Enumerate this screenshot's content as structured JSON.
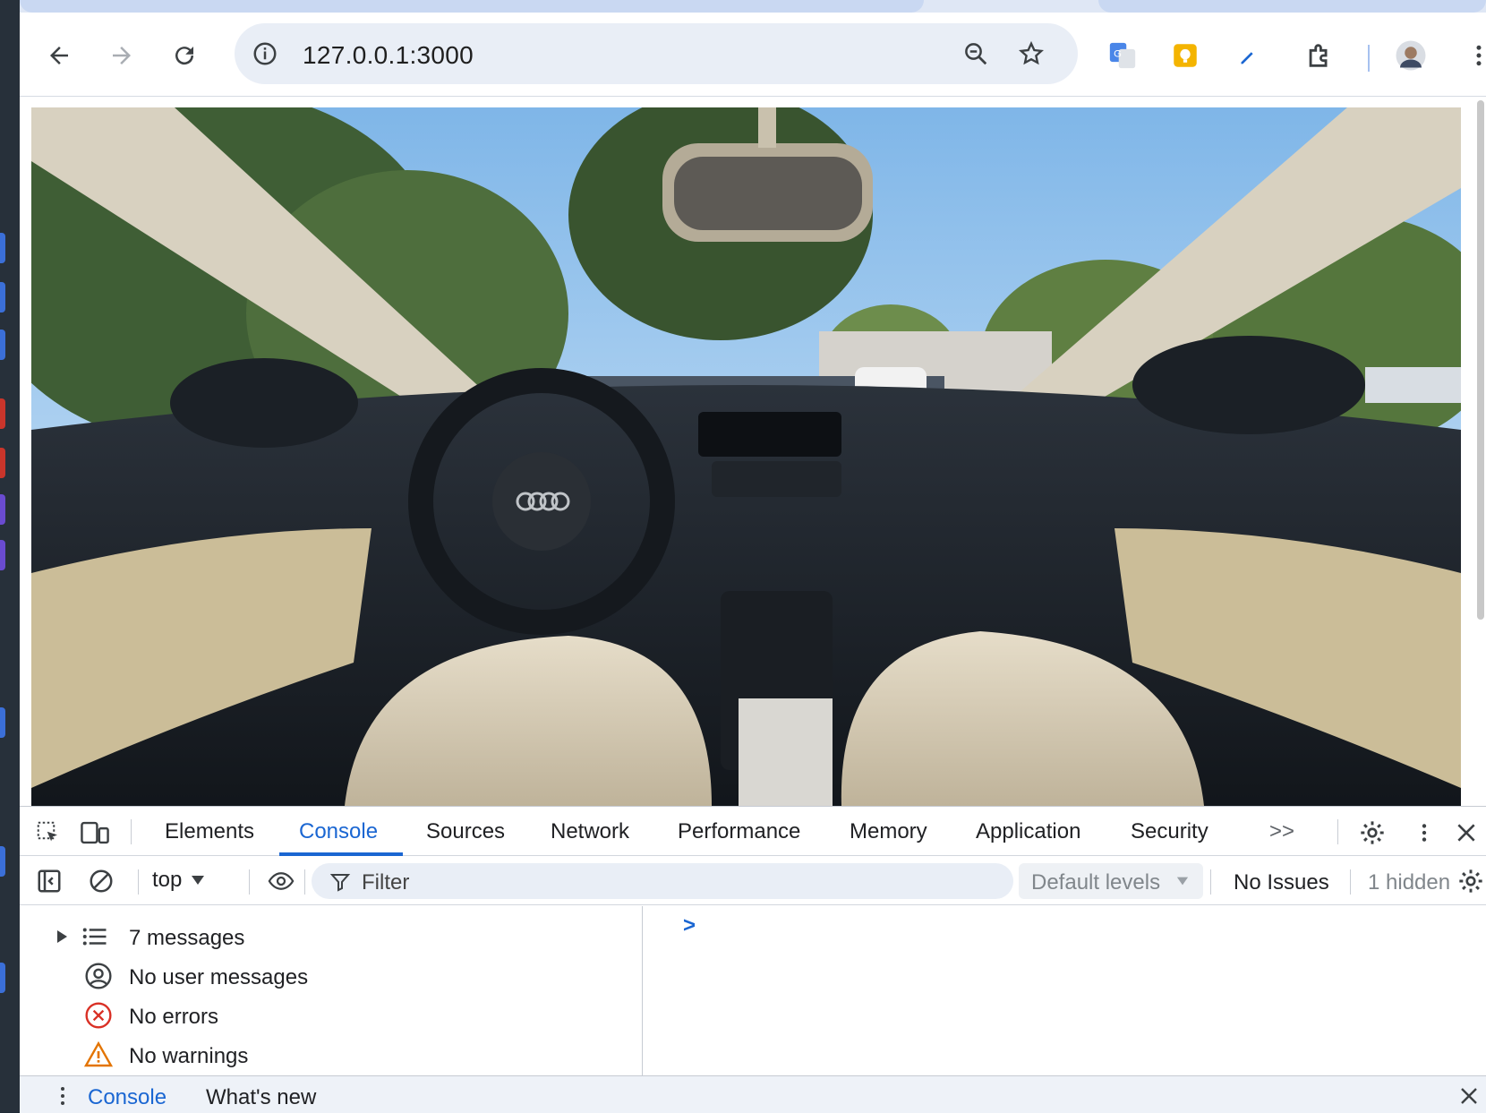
{
  "browser": {
    "url": "127.0.0.1:3000"
  },
  "page": {
    "image_description_icon": "car-interior-photo"
  },
  "devtools": {
    "tabs": [
      "Elements",
      "Console",
      "Sources",
      "Network",
      "Performance",
      "Memory",
      "Application",
      "Security"
    ],
    "active_tab": "Console",
    "more_tabs_label": ">>",
    "context": "top",
    "filter_placeholder": "Filter",
    "levels": "Default levels",
    "issues": "No Issues",
    "hidden": "1 hidden",
    "sidebar": [
      {
        "label": "7 messages",
        "icon": "list-icon"
      },
      {
        "label": "No user messages",
        "icon": "user-icon"
      },
      {
        "label": "No errors",
        "icon": "error-icon"
      },
      {
        "label": "No warnings",
        "icon": "warning-icon"
      }
    ],
    "prompt": ">",
    "drawer": {
      "tabs": [
        "Console",
        "What's new"
      ]
    }
  },
  "colors": {
    "accent": "#1a66d2",
    "error": "#d93025",
    "warning": "#e37400"
  }
}
